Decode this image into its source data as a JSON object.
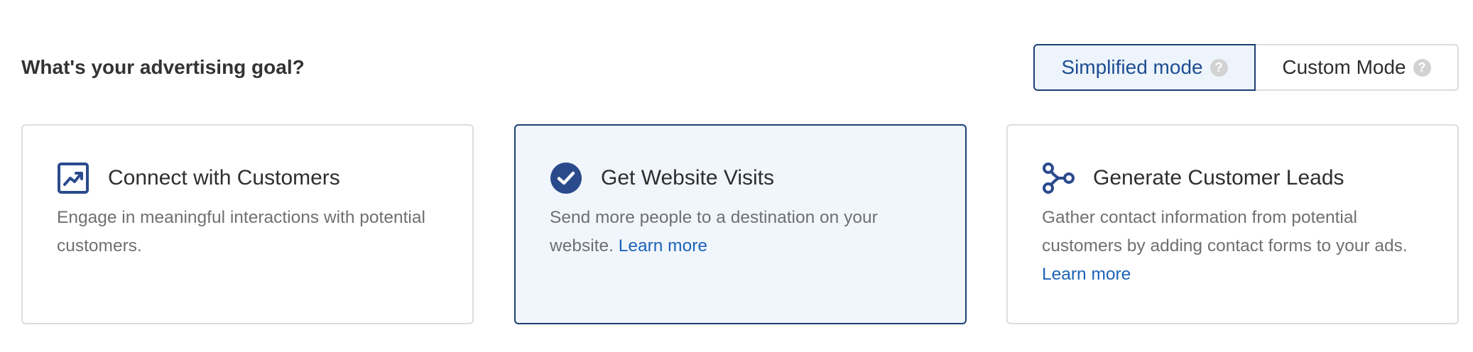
{
  "header": {
    "title": "What's your advertising goal?"
  },
  "modes": {
    "simplified_label": "Simplified mode",
    "custom_label": "Custom Mode",
    "selected": "Simplified mode"
  },
  "cards": [
    {
      "title": "Connect with Customers",
      "description": "Engage in meaningful interactions with potential customers.",
      "icon": "chart-trend-icon",
      "selected": false
    },
    {
      "title": "Get Website Visits",
      "description": "Send more people to a destination on your website.",
      "link": "Learn more",
      "icon": "checkmark-circle-icon",
      "selected": true
    },
    {
      "title": "Generate Customer Leads",
      "description": "Gather contact information from potential customers by adding contact forms to your ads.",
      "link": "Learn more",
      "icon": "share-nodes-icon",
      "selected": false
    }
  ],
  "colors": {
    "accent": "#1d3f73",
    "link": "#1d63b7",
    "selected_bg": "#f1f6fc",
    "icon_blue": "#2a4a8c"
  }
}
